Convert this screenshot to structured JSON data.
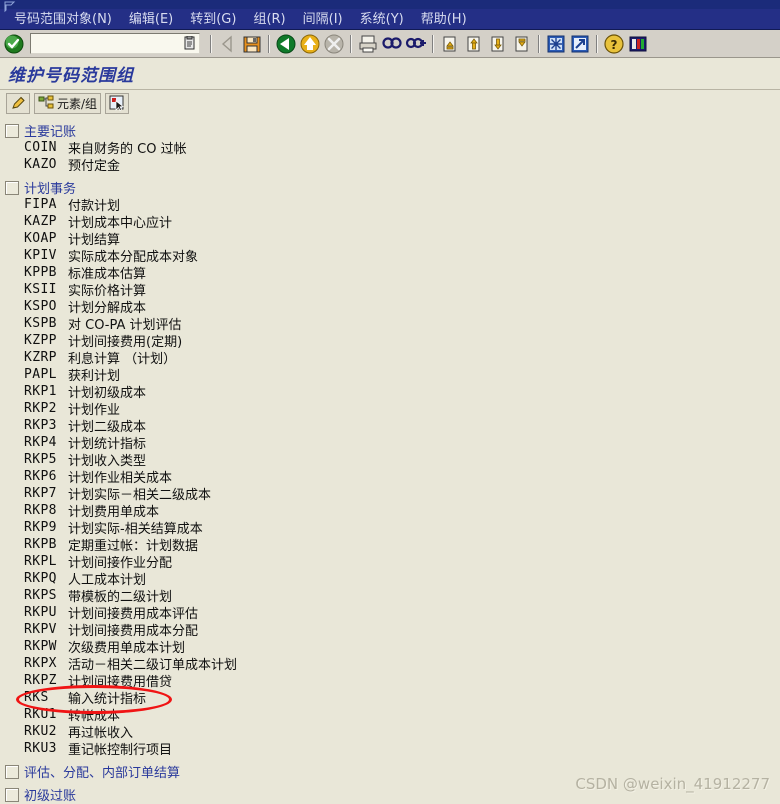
{
  "window": {
    "icon": "sap-window-icon"
  },
  "menubar": {
    "items": [
      {
        "label": "号码范围对象(N)",
        "name": "menu-number-range-object"
      },
      {
        "label": "编辑(E)",
        "name": "menu-edit"
      },
      {
        "label": "转到(G)",
        "name": "menu-goto"
      },
      {
        "label": "组(R)",
        "name": "menu-group"
      },
      {
        "label": "间隔(I)",
        "name": "menu-interval"
      },
      {
        "label": "系统(Y)",
        "name": "menu-system"
      },
      {
        "label": "帮助(H)",
        "name": "menu-help"
      }
    ]
  },
  "toolbar": {
    "ok_icon": "green-check-icon",
    "command_value": "",
    "command_placeholder": "",
    "dropdown_icon": "command-history-icon",
    "icons": [
      {
        "name": "back-arrow-icon",
        "glyph": "◁"
      },
      {
        "name": "save-icon",
        "glyph": "💾"
      },
      {
        "name": "back-green-icon",
        "glyph": "⬅"
      },
      {
        "name": "exit-yellow-icon",
        "glyph": "⬆"
      },
      {
        "name": "cancel-icon",
        "glyph": "✖"
      },
      {
        "name": "print-icon",
        "glyph": "🖨"
      },
      {
        "name": "find-icon",
        "glyph": "🔍"
      },
      {
        "name": "find-next-icon",
        "glyph": "🔎"
      },
      {
        "name": "first-page-icon",
        "glyph": "⏮"
      },
      {
        "name": "previous-page-icon",
        "glyph": "⬆"
      },
      {
        "name": "next-page-icon",
        "glyph": "⬇"
      },
      {
        "name": "last-page-icon",
        "glyph": "⏭"
      },
      {
        "name": "create-session-icon",
        "glyph": "✳"
      },
      {
        "name": "create-shortcut-icon",
        "glyph": "↗"
      },
      {
        "name": "help-icon",
        "glyph": "?"
      },
      {
        "name": "customize-layout-icon",
        "glyph": "▤"
      }
    ]
  },
  "page": {
    "title": "维护号码范围组"
  },
  "app_toolbar": {
    "buttons": [
      {
        "name": "edit-pencil-button",
        "label": "",
        "icon": "pencil-icon"
      },
      {
        "name": "element-group-button",
        "label": "元素/组",
        "icon": "element-group-icon"
      },
      {
        "name": "select-button",
        "label": "",
        "icon": "cursor-select-icon"
      }
    ]
  },
  "tree": {
    "groups": [
      {
        "name": "group-main-posting",
        "label": "主要记账",
        "items": [
          {
            "code": "COIN",
            "text": "来自财务的 CO 过帐"
          },
          {
            "code": "KAZO",
            "text": "预付定金"
          }
        ]
      },
      {
        "name": "group-planning-transactions",
        "label": "计划事务",
        "items": [
          {
            "code": "FIPA",
            "text": "付款计划"
          },
          {
            "code": "KAZP",
            "text": "计划成本中心应计"
          },
          {
            "code": "KOAP",
            "text": "计划结算"
          },
          {
            "code": "KPIV",
            "text": "实际成本分配成本对象"
          },
          {
            "code": "KPPB",
            "text": "标准成本估算"
          },
          {
            "code": "KSII",
            "text": "实际价格计算"
          },
          {
            "code": "KSPO",
            "text": "计划分解成本"
          },
          {
            "code": "KSPB",
            "text": "对 CO-PA 计划评估"
          },
          {
            "code": "KZPP",
            "text": "计划间接费用(定期)"
          },
          {
            "code": "KZRP",
            "text": "利息计算 （计划）"
          },
          {
            "code": "PAPL",
            "text": "获利计划"
          },
          {
            "code": "RKP1",
            "text": "计划初级成本"
          },
          {
            "code": "RKP2",
            "text": "计划作业"
          },
          {
            "code": "RKP3",
            "text": "计划二级成本"
          },
          {
            "code": "RKP4",
            "text": "计划统计指标"
          },
          {
            "code": "RKP5",
            "text": "计划收入类型"
          },
          {
            "code": "RKP6",
            "text": "计划作业相关成本"
          },
          {
            "code": "RKP7",
            "text": "计划实际－相关二级成本"
          },
          {
            "code": "RKP8",
            "text": "计划费用单成本"
          },
          {
            "code": "RKP9",
            "text": "计划实际-相关结算成本"
          },
          {
            "code": "RKPB",
            "text": "定期重过帐：计划数据"
          },
          {
            "code": "RKPL",
            "text": "计划间接作业分配"
          },
          {
            "code": "RKPQ",
            "text": "人工成本计划"
          },
          {
            "code": "RKPS",
            "text": "带模板的二级计划"
          },
          {
            "code": "RKPU",
            "text": "计划间接费用成本评估"
          },
          {
            "code": "RKPV",
            "text": "计划间接费用成本分配"
          },
          {
            "code": "RKPW",
            "text": "次级费用单成本计划"
          },
          {
            "code": "RKPX",
            "text": "活动－相关二级订单成本计划"
          },
          {
            "code": "RKPZ",
            "text": "计划间接费用借贷"
          },
          {
            "code": "RKS",
            "text": "输入统计指标",
            "highlighted": true
          },
          {
            "code": "RKU1",
            "text": "转帐成本"
          },
          {
            "code": "RKU2",
            "text": "再过帐收入"
          },
          {
            "code": "RKU3",
            "text": "重记帐控制行项目"
          }
        ]
      },
      {
        "name": "group-assessment-distribution",
        "label": "评估、分配、内部订单结算",
        "items": []
      },
      {
        "name": "group-primary-posting",
        "label": "初级过账",
        "items": []
      }
    ]
  },
  "annotation": {
    "highlight_code": "RKS",
    "color": "#f01414"
  },
  "watermark": {
    "text": "CSDN @weixin_41912277"
  }
}
